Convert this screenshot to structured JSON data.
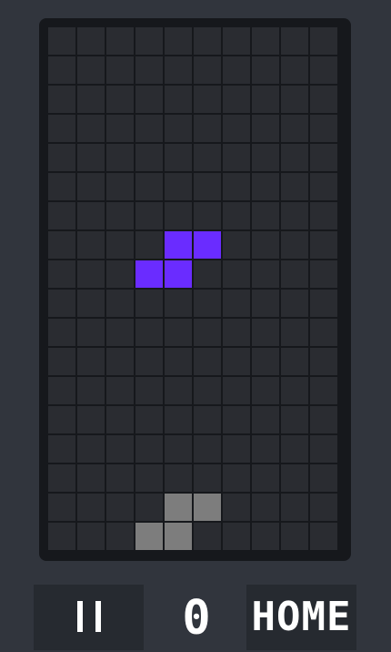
{
  "game": {
    "columns": 10,
    "rows": 18,
    "active_piece": {
      "color": "#6a2cff",
      "cells": [
        [
          4,
          7
        ],
        [
          5,
          7
        ],
        [
          3,
          8
        ],
        [
          4,
          8
        ]
      ]
    },
    "ghost_piece": {
      "color": "#7d7d7d",
      "cells": [
        [
          4,
          16
        ],
        [
          5,
          16
        ],
        [
          3,
          17
        ],
        [
          4,
          17
        ]
      ]
    },
    "empty_color": "#2a2c31",
    "board_color": "#16181c"
  },
  "controls": {
    "pause_icon": "pause-icon",
    "score": "0",
    "home_label": "HOME"
  }
}
